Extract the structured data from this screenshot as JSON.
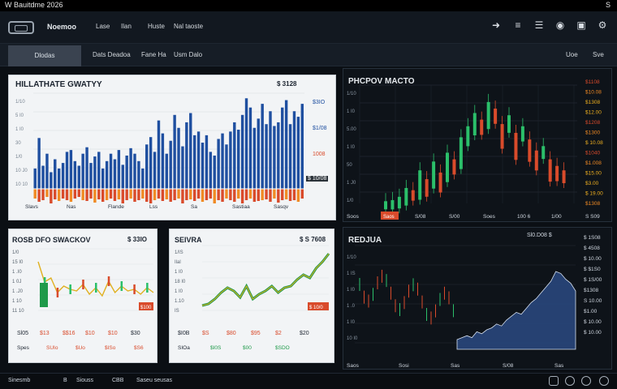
{
  "titlebar": {
    "title": "W Bauitdme 2026",
    "corner": "S"
  },
  "appbar": {
    "brand": "Noemoo",
    "menu": [
      "Lase",
      "Ilan",
      "Huste",
      "Nal taoste"
    ],
    "icons": [
      "cursor-icon",
      "list-icon",
      "menu-icon",
      "globe-icon",
      "lock-icon",
      "settings-icon"
    ]
  },
  "subbar": {
    "active_tab": "Dlodas",
    "items": [
      "Dats Deadoa",
      "Fane  Ha",
      "Usm Dalo"
    ],
    "right": [
      "Uoe",
      "Sve"
    ]
  },
  "panels": {
    "main": {
      "title": "HILLATHATE GWATYY",
      "price": "$ 3128",
      "tag": "5 0008",
      "right_labels": [
        "$3IO",
        "$1/08",
        "1008",
        "$ 10/08"
      ],
      "left_ticks": [
        "1/10",
        "5 I0",
        "1 I0",
        "30",
        "1/0",
        "10 J0",
        "10 10"
      ],
      "x_labels": [
        "Slavs",
        "Nas",
        "Flande",
        "Lss",
        "Sa",
        "Sastiaa",
        "Sasqv"
      ],
      "chart_data": {
        "type": "bar",
        "title": "HILLATHATE GWATYY",
        "series": [
          {
            "values": [
              22,
              55,
              25,
              38,
              18,
              32,
              22,
              28,
              40,
              42,
              30,
              25,
              38,
              45,
              28,
              35,
              40,
              22,
              30,
              38,
              32,
              42,
              26,
              36,
              44,
              38,
              30,
              22,
              48,
              56,
              40,
              74,
              60,
              38,
              52,
              80,
              66,
              46,
              72,
              82,
              58,
              62,
              50,
              58,
              40,
              36,
              54,
              60,
              48,
              62,
              72,
              64,
              80,
              98,
              88,
              66,
              76,
              92,
              70,
              84,
              68,
              72,
              88,
              96,
              70,
              84,
              78,
              92
            ]
          },
          {
            "values": [
              12,
              16,
              14,
              10,
              18,
              13,
              15,
              12,
              14,
              16,
              12,
              10,
              14,
              15,
              12,
              17,
              13,
              16,
              14,
              12,
              15,
              13,
              18,
              14,
              12,
              16,
              14,
              12,
              16,
              18,
              14,
              12,
              15,
              13,
              16,
              14,
              12,
              18,
              14,
              13,
              15,
              12,
              16,
              14,
              12,
              18,
              14,
              16,
              12,
              14,
              16,
              12,
              18,
              14,
              12,
              16,
              15,
              14,
              13,
              16,
              12,
              17,
              14,
              13,
              15,
              14,
              16,
              12
            ]
          }
        ]
      }
    },
    "top_right": {
      "title": "PHCPOV MACTO",
      "right_labels": [
        "$1108",
        "$10.08",
        "$1308",
        "$12.00",
        "$1208",
        "$1300",
        "$ 10.08",
        "$1040",
        "$1.008",
        "$15.00",
        "$3.00",
        "$ 19.00",
        "$1308"
      ],
      "left_ticks": [
        "1/10",
        "1 I0",
        "5.00",
        "1 I0",
        "50",
        "1 J0",
        "1/0"
      ],
      "x_labels": [
        "Soos",
        "Sas",
        "S/08",
        "S/00",
        "Soes",
        "100 6",
        "1/00",
        "S S09"
      ],
      "tag": "Saos",
      "chart_data": {
        "type": "line",
        "title": "PHCPOV MACTO",
        "series": [
          {
            "values": [
              2,
              3,
              6,
              14,
              12,
              30,
              22,
              38,
              28,
              46,
              40,
              60,
              70,
              82,
              76,
              92,
              86,
              72,
              80,
              64,
              70,
              58,
              48,
              52,
              40,
              34,
              30
            ]
          }
        ]
      }
    },
    "mid_left": {
      "title": "ROSB DFO SWACKOV",
      "price": "$ 33IO",
      "tag": "$100",
      "left_ticks": [
        "1/0",
        "15 I0",
        "1 .I0",
        "1 0J",
        "1 .J0",
        "1 10",
        "11 10"
      ],
      "bottom": [
        "Sl05",
        "$13",
        "$$16",
        "$10",
        "$10",
        "$30"
      ],
      "bottom2": [
        "Spes",
        "SUIo",
        "$Uo",
        "$ISo",
        "$S6"
      ],
      "chart_data": {
        "type": "line",
        "title": "ROSB DFO SWACKOV",
        "series": [
          {
            "values": [
              60,
              35,
              40,
              22,
              30,
              26,
              24,
              32,
              20,
              28,
              18,
              36,
              22,
              30,
              24,
              26,
              20,
              28,
              22
            ]
          }
        ]
      }
    },
    "mid_center": {
      "title": "SEIVRA",
      "price": "$ S 7608",
      "tag": "$ 10/0",
      "left_ticks": [
        "1/IS",
        "Ilal",
        "1 I0",
        "18 I0",
        "1 I0",
        "1.10",
        "IS"
      ],
      "bottom": [
        "$I0B",
        "$S",
        "$80",
        "$95",
        "$2",
        "$20"
      ],
      "bottom2": [
        "SIOa",
        "$I0S",
        "$00",
        "$SDO"
      ],
      "chart_data": {
        "type": "line",
        "title": "SEIVRA",
        "series": [
          {
            "values": [
              6,
              8,
              14,
              22,
              28,
              24,
              16,
              30,
              14,
              20,
              24,
              30,
              22,
              28,
              30,
              38,
              44,
              40,
              52,
              60,
              70
            ]
          }
        ]
      }
    },
    "mid_right": {
      "title": "REDJUA",
      "top_label": "Sl0.D08 $",
      "right_labels": [
        "$ 1S08",
        "$ 4508",
        "$ 10.00",
        "$ $1S0",
        "$ 1S/00",
        "$1308",
        "S 10.00",
        "$1.00",
        "$ 10.00",
        "$ 10.00"
      ],
      "left_ticks": [
        "1/10",
        "1 IS",
        "1 I0",
        "1 .0",
        "1 I0",
        "10 I0"
      ],
      "x_labels": [
        "Saos",
        "Sosi",
        "Sas",
        "S/08",
        "Sas"
      ],
      "chart_data": {
        "type": "area",
        "title": "REDJUA",
        "series": [
          {
            "values": [
              10,
              12,
              14,
              12,
              18,
              16,
              20,
              22,
              26,
              24,
              30,
              34,
              38,
              36,
              42,
              48,
              52,
              58,
              64,
              70,
              80,
              78,
              72,
              68,
              60
            ]
          }
        ]
      }
    }
  },
  "statusbar": {
    "left": [
      "Sinesmb",
      "B",
      "Siouss",
      "CBB",
      "Saseu seusas"
    ],
    "icons": [
      "window-icon",
      "chat-icon",
      "share-icon",
      "settings-icon"
    ]
  },
  "colors": {
    "blue": "#1f4fa0",
    "red": "#d94b2b",
    "green": "#2bbf6a",
    "orange": "#f08a24"
  }
}
